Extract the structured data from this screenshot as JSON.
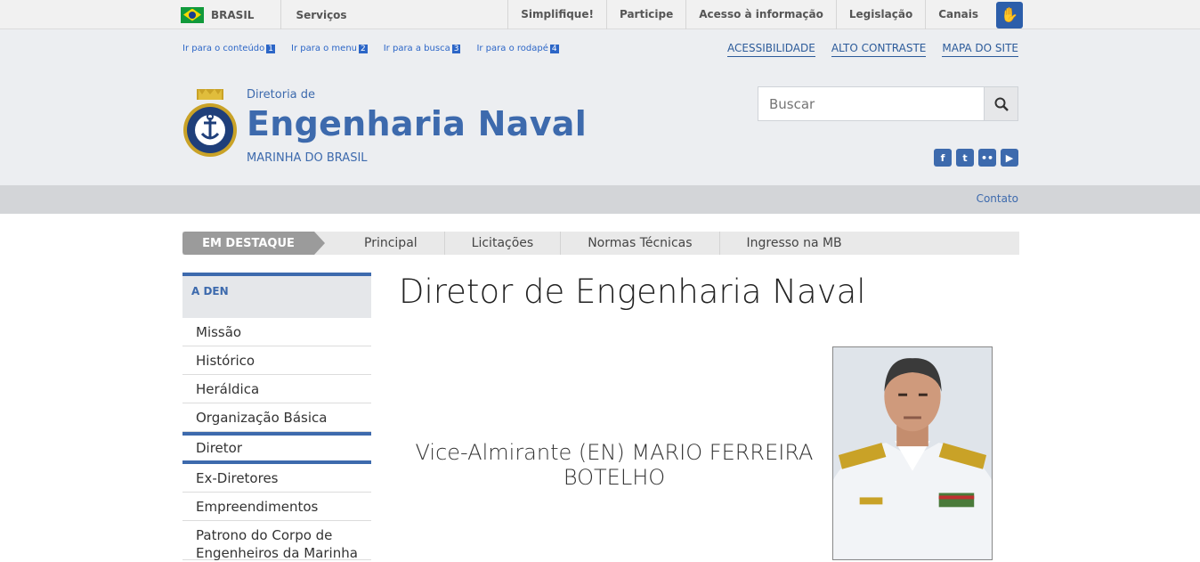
{
  "govbar": {
    "country": "BRASIL",
    "services": "Serviços",
    "links": [
      "Simplifique!",
      "Participe",
      "Acesso à informação",
      "Legislação",
      "Canais"
    ]
  },
  "skip_links": [
    {
      "label": "Ir para o conteúdo",
      "num": "1"
    },
    {
      "label": "Ir para o menu",
      "num": "2"
    },
    {
      "label": "Ir para a busca",
      "num": "3"
    },
    {
      "label": "Ir para o rodapé",
      "num": "4"
    }
  ],
  "accessibility": [
    "ACESSIBILIDADE",
    "ALTO CONTRASTE",
    "MAPA DO SITE"
  ],
  "header": {
    "small": "Diretoria de",
    "title": "Engenharia Naval",
    "subtitle": "MARINHA DO BRASIL",
    "logo_text": "MARINHA DO BRASIL"
  },
  "search": {
    "placeholder": "Buscar"
  },
  "social": [
    "facebook-icon",
    "twitter-icon",
    "flickr-icon",
    "youtube-icon"
  ],
  "contact": "Contato",
  "nav": {
    "highlight": "EM DESTAQUE",
    "items": [
      "Principal",
      "Licitações",
      "Normas Técnicas",
      "Ingresso na MB"
    ]
  },
  "sidebar": {
    "heading": "A DEN",
    "items": [
      "Missão",
      "Histórico",
      "Heráldica",
      "Organização Básica",
      "Diretor",
      "Ex-Diretores",
      "Empreendimentos",
      "Patrono do Corpo de Engenheiros da Marinha"
    ]
  },
  "content": {
    "title": "Diretor de Engenharia Naval",
    "director_line1": "Vice-Almirante (EN) MARIO FERREIRA",
    "director_line2": "BOTELHO"
  },
  "colors": {
    "brand": "#3d6aad",
    "nav_highlight": "#9b9b9b"
  }
}
